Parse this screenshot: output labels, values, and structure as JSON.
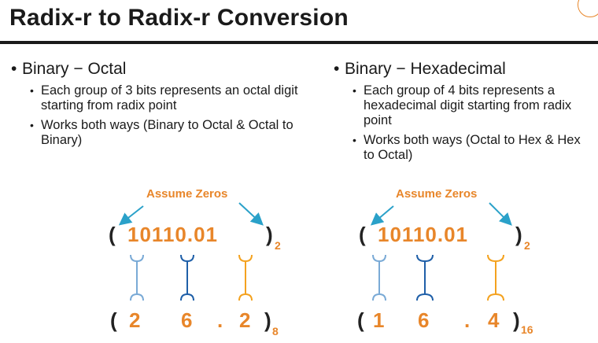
{
  "slide": {
    "title": "Radix-r to Radix-r Conversion"
  },
  "left": {
    "heading": "Binary − Octal",
    "bullets": [
      "Each group of 3 bits represents an octal digit starting from radix point",
      "Works both ways (Binary to Octal & Octal to Binary)"
    ],
    "annotation": "Assume Zeros",
    "top_open": "(",
    "top_digits": "10110.01",
    "top_close": ")",
    "top_radix": "2",
    "result_open": "(",
    "result_digits": [
      "2",
      "6",
      ".",
      "2"
    ],
    "result_close": ")",
    "result_radix": "8"
  },
  "right": {
    "heading": "Binary − Hexadecimal",
    "bullets": [
      "Each group of 4 bits represents a hexadecimal digit starting from radix point",
      "Works both ways (Octal to Hex & Hex to Octal)"
    ],
    "annotation": "Assume Zeros",
    "top_open": "(",
    "top_digits": "10110.01",
    "top_close": ")",
    "top_radix": "2",
    "result_open": "(",
    "result_digits": [
      "1",
      "6",
      ".",
      "4"
    ],
    "result_close": ")",
    "result_radix": "16"
  },
  "colors": {
    "accent_orange": "#e8862a",
    "arrow_teal": "#2aa1c9",
    "brace_light_blue": "#7aaad6",
    "brace_dark_blue": "#1f5fa8",
    "brace_orange": "#f4a21f"
  }
}
